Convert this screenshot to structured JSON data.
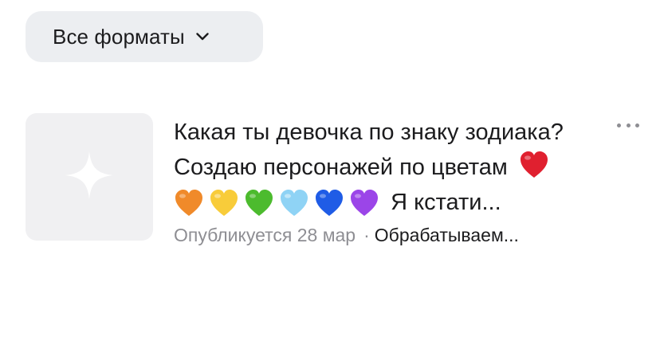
{
  "filter": {
    "label": "Все форматы",
    "icon": "chevron-down-icon"
  },
  "post": {
    "thumbnail_icon": "sparkle-icon",
    "caption_line1": "Какая ты девочка по знаку зодиака?",
    "caption_line2": "Создаю персонажей по цветам",
    "caption_line2_emoji": "red-heart-icon",
    "caption_line3_emojis": [
      "orange-heart-icon",
      "yellow-heart-icon",
      "green-heart-icon",
      "light-blue-heart-icon",
      "blue-heart-icon",
      "purple-heart-icon"
    ],
    "caption_line3_text": "Я кстати...",
    "publish_time": "Опубликуется 28 мар",
    "separator": "·",
    "status": "Обрабатываем...",
    "more_icon": "more-horizontal-icon"
  },
  "colors": {
    "red": "#e0202f",
    "orange": "#f08a2a",
    "yellow": "#f8cc3a",
    "green": "#4cbb2e",
    "light_blue": "#8fd3f5",
    "blue": "#1f5ce6",
    "purple": "#9b45e8"
  }
}
